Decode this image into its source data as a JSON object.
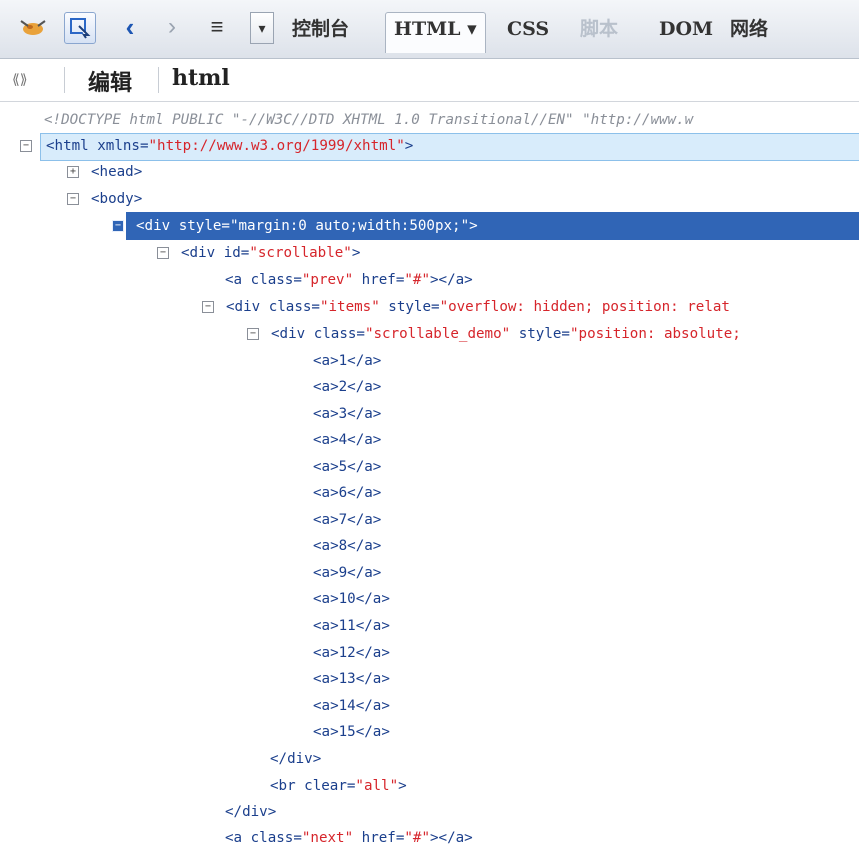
{
  "toolbar": {
    "icons": [
      "firebug-icon",
      "inspect-icon",
      "back-icon",
      "forward-icon",
      "console-menu-icon",
      "dropdown-arrow-icon"
    ],
    "tabs": [
      "控制台",
      "HTML",
      "CSS",
      "脚本",
      "DOM",
      "网络"
    ],
    "active_tab": "HTML",
    "dropdown_arrow": "▾"
  },
  "subbar": {
    "edit_label": "编辑",
    "breadcrumb": "html"
  },
  "code": {
    "doctype": "<!DOCTYPE html PUBLIC \"-//W3C//DTD XHTML 1.0 Transitional//EN\" \"http://www.w",
    "html_open_a": "<html xmlns=",
    "html_open_v": "\"http://www.w3.org/1999/xhtml\"",
    "html_open_b": ">",
    "head": "<head>",
    "body": "<body>",
    "div_sel_a": "<div style=",
    "div_sel_v": "\"margin:0 auto;width:500px;\"",
    "div_sel_b": ">",
    "scrollable_a": "<div id=",
    "scrollable_v": "\"scrollable\"",
    "scrollable_b": ">",
    "prev_a": "<a class=",
    "prev_v": "\"prev\"",
    "prev_b": " href=",
    "prev_v2": "\"#\"",
    "prev_c": "></a>",
    "items_a": "<div class=",
    "items_v": "\"items\"",
    "items_b": " style=",
    "items_v2": "\"overflow: hidden; position: relat",
    "demo_a": "<div class=",
    "demo_v": "\"scrollable_demo\"",
    "demo_b": " style=",
    "demo_v2": "\"position: absolute;",
    "anchors": [
      "<a>1</a>",
      "<a>2</a>",
      "<a>3</a>",
      "<a>4</a>",
      "<a>5</a>",
      "<a>6</a>",
      "<a>7</a>",
      "<a>8</a>",
      "<a>9</a>",
      "<a>10</a>",
      "<a>11</a>",
      "<a>12</a>",
      "<a>13</a>",
      "<a>14</a>",
      "<a>15</a>"
    ],
    "div_close_1": "</div>",
    "br_a": "<br clear=",
    "br_v": "\"all\"",
    "br_b": ">",
    "div_close_2": "</div>",
    "next_a": "<a class=",
    "next_v": "\"next\"",
    "next_b": " href=",
    "next_v2": "\"#\"",
    "next_c": "></a>"
  },
  "colors": {
    "tag": "#1b3f8c",
    "attr_value": "#d6252b",
    "selection": "#3065b6",
    "hover_row": "#d8ecfb"
  }
}
